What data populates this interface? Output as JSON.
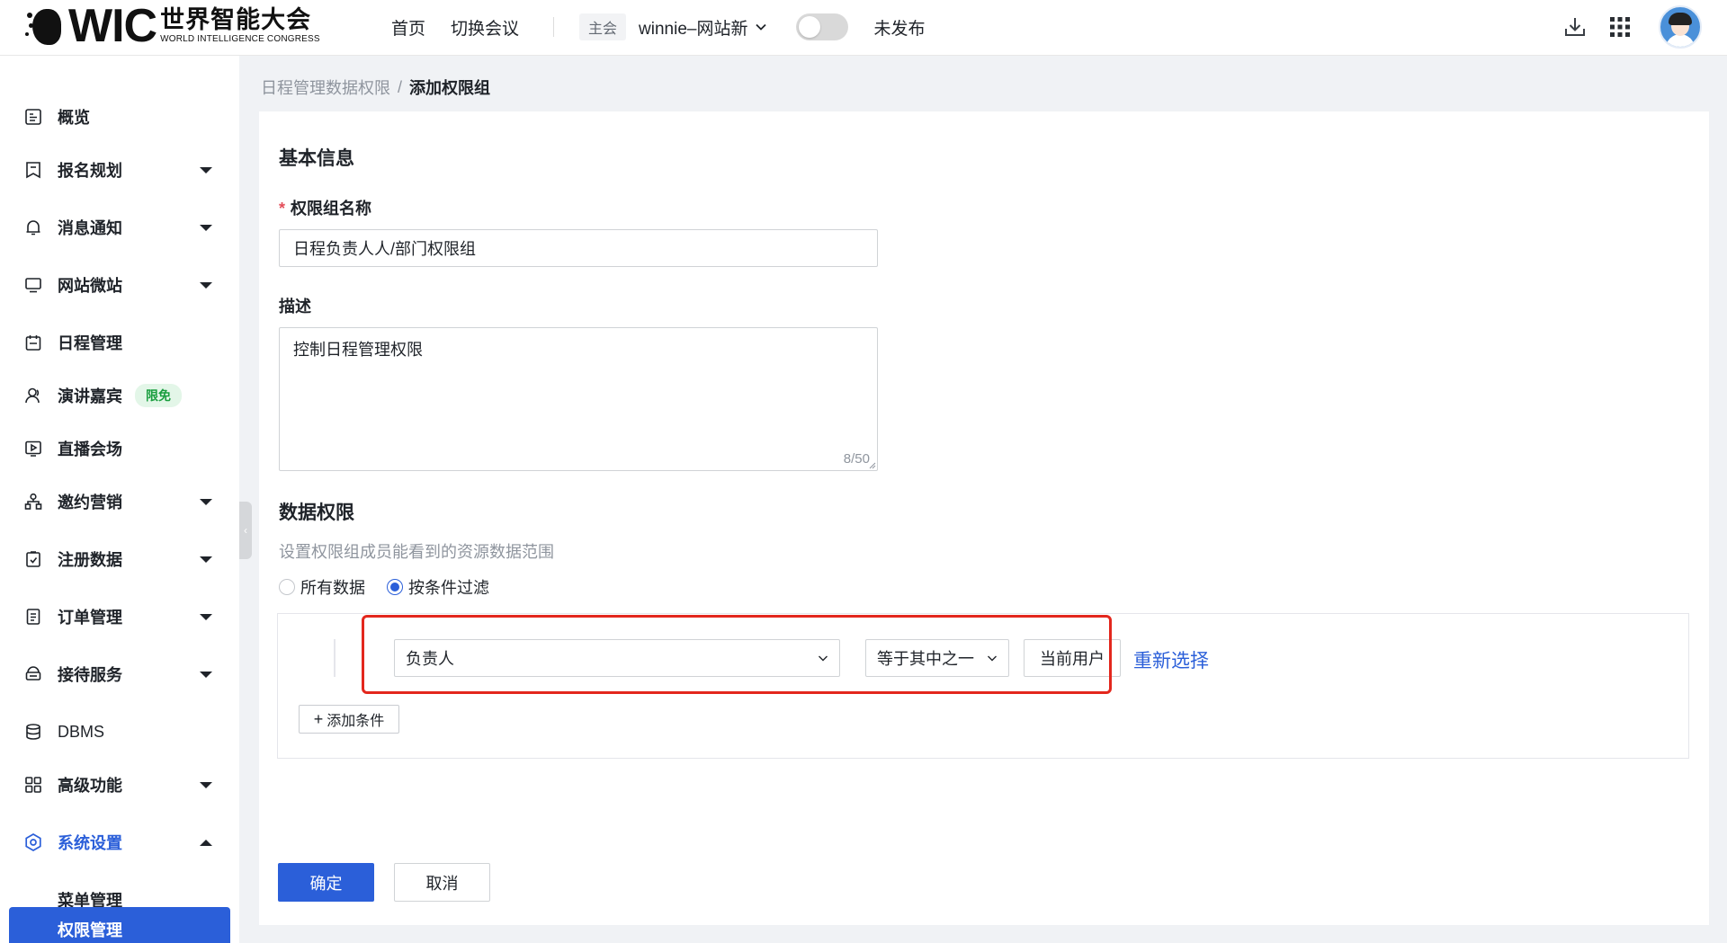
{
  "logo": {
    "wic": "WIC",
    "cn": "世界智能大会",
    "en": "WORLD INTELLIGENCE CONGRESS"
  },
  "topbar": {
    "nav": [
      "首页",
      "切换会议"
    ],
    "main_tag": "主会",
    "conference_name": "winnie–网站新",
    "publish_status": "未发布",
    "publish_toggle_on": false,
    "icons": [
      "download-icon",
      "apps-grid-icon",
      "user-avatar"
    ]
  },
  "sidebar": {
    "items": [
      {
        "label": "概览",
        "icon": "overview-icon",
        "expandable": false
      },
      {
        "label": "报名规划",
        "icon": "bookmark-icon",
        "expandable": true
      },
      {
        "label": "消息通知",
        "icon": "bell-icon",
        "expandable": true
      },
      {
        "label": "网站微站",
        "icon": "monitor-icon",
        "expandable": true
      },
      {
        "label": "日程管理",
        "icon": "calendar-icon",
        "expandable": false
      },
      {
        "label": "演讲嘉宾",
        "icon": "person-icon",
        "expandable": false,
        "badge": "限免"
      },
      {
        "label": "直播会场",
        "icon": "play-icon",
        "expandable": false
      },
      {
        "label": "邀约营销",
        "icon": "network-icon",
        "expandable": true
      },
      {
        "label": "注册数据",
        "icon": "clipboard-icon",
        "expandable": true
      },
      {
        "label": "订单管理",
        "icon": "document-icon",
        "expandable": true
      },
      {
        "label": "接待服务",
        "icon": "service-icon",
        "expandable": true
      },
      {
        "label": "DBMS",
        "icon": "database-icon",
        "expandable": false
      },
      {
        "label": "高级功能",
        "icon": "grid-icon",
        "expandable": true
      },
      {
        "label": "系统设置",
        "icon": "settings-icon",
        "expandable": true,
        "expanded": true,
        "active": true
      }
    ],
    "sub_items": [
      {
        "label": "菜单管理",
        "selected": false
      },
      {
        "label": "权限管理",
        "selected": true
      }
    ]
  },
  "breadcrumb": {
    "parent": "日程管理数据权限",
    "separator": "/",
    "current": "添加权限组"
  },
  "form": {
    "basic_title": "基本信息",
    "name_label": "权限组名称",
    "name_required_mark": "*",
    "name_value": "日程负责人人/部门权限组",
    "desc_label": "描述",
    "desc_value": "控制日程管理权限",
    "desc_count": "8/50",
    "data_title": "数据权限",
    "data_hint": "设置权限组成员能看到的资源数据范围",
    "radio_options": [
      {
        "label": "所有数据",
        "checked": false
      },
      {
        "label": "按条件过滤",
        "checked": true
      }
    ],
    "condition": {
      "field": "负责人",
      "operator": "等于其中之一",
      "value": "当前用户",
      "reselect": "重新选择"
    },
    "add_condition": "添加条件",
    "confirm": "确定",
    "cancel": "取消"
  },
  "colors": {
    "primary": "#2b5fd9",
    "highlight_border": "#e3271d",
    "badge_bg": "#e3f6e8",
    "badge_text": "#1a9e3f"
  }
}
